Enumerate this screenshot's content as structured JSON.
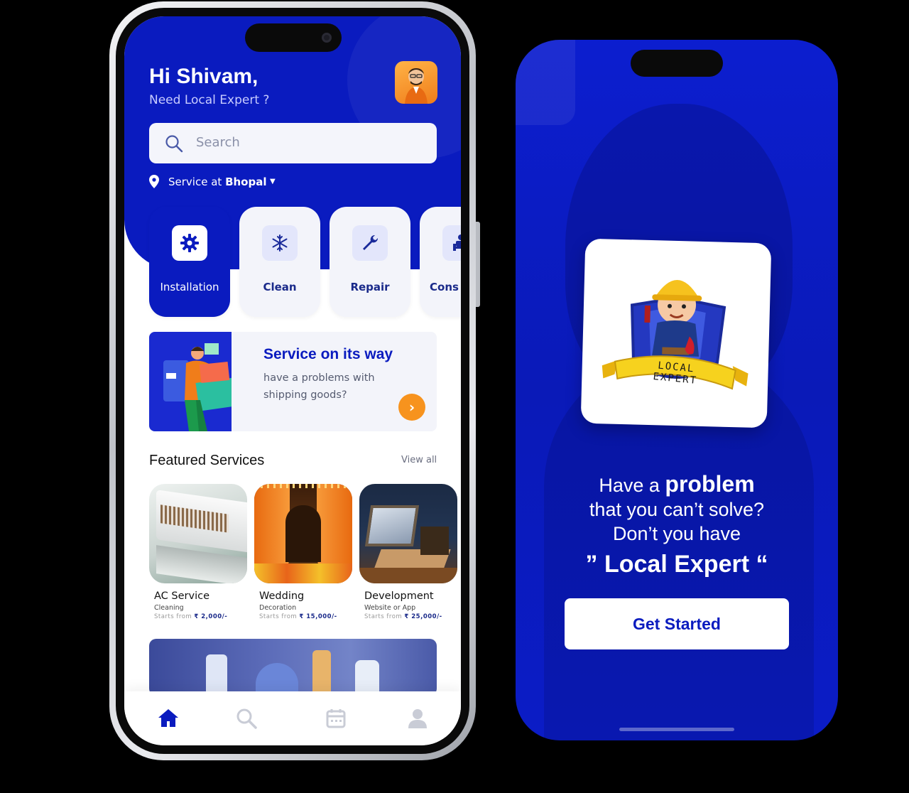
{
  "colors": {
    "brand": "#0a1bbf",
    "accent": "#f7931e",
    "surface": "#f3f4fa"
  },
  "home": {
    "greeting": "Hi Shivam,",
    "subtitle": "Need Local Expert ?",
    "search_placeholder": "Search",
    "location_prefix": "Service at",
    "location_city": "Bhopal",
    "categories": [
      {
        "label": "Installation",
        "icon": "gear-icon",
        "active": true
      },
      {
        "label": "Clean",
        "icon": "snowflake-icon",
        "active": false
      },
      {
        "label": "Repair",
        "icon": "wrench-icon",
        "active": false
      },
      {
        "label": "Cons",
        "icon": "person-desk-icon",
        "active": false
      }
    ],
    "banner": {
      "title": "Service on its way",
      "desc": "have a problems with shipping goods?"
    },
    "featured_title": "Featured Services",
    "view_all": "View all",
    "services": [
      {
        "name": "AC Service",
        "sub": "Cleaning",
        "price_prefix": "Starts from",
        "price": "₹ 2,000/-"
      },
      {
        "name": "Wedding",
        "sub": "Decoration",
        "price_prefix": "Starts from",
        "price": "₹ 15,000/-"
      },
      {
        "name": "Development",
        "sub": "Website or App",
        "price_prefix": "Starts from",
        "price": "₹ 25,000/-"
      }
    ],
    "tabs": [
      "home-icon",
      "search-icon",
      "calendar-icon",
      "profile-icon"
    ]
  },
  "onboarding": {
    "logo_text": "LOCAL EXPERT",
    "line1_a": "Have a ",
    "line1_b": "problem",
    "line2": "that you can’t solve?",
    "line3": "Don’t you have",
    "line4": "” Local Expert “",
    "cta": "Get Started"
  }
}
